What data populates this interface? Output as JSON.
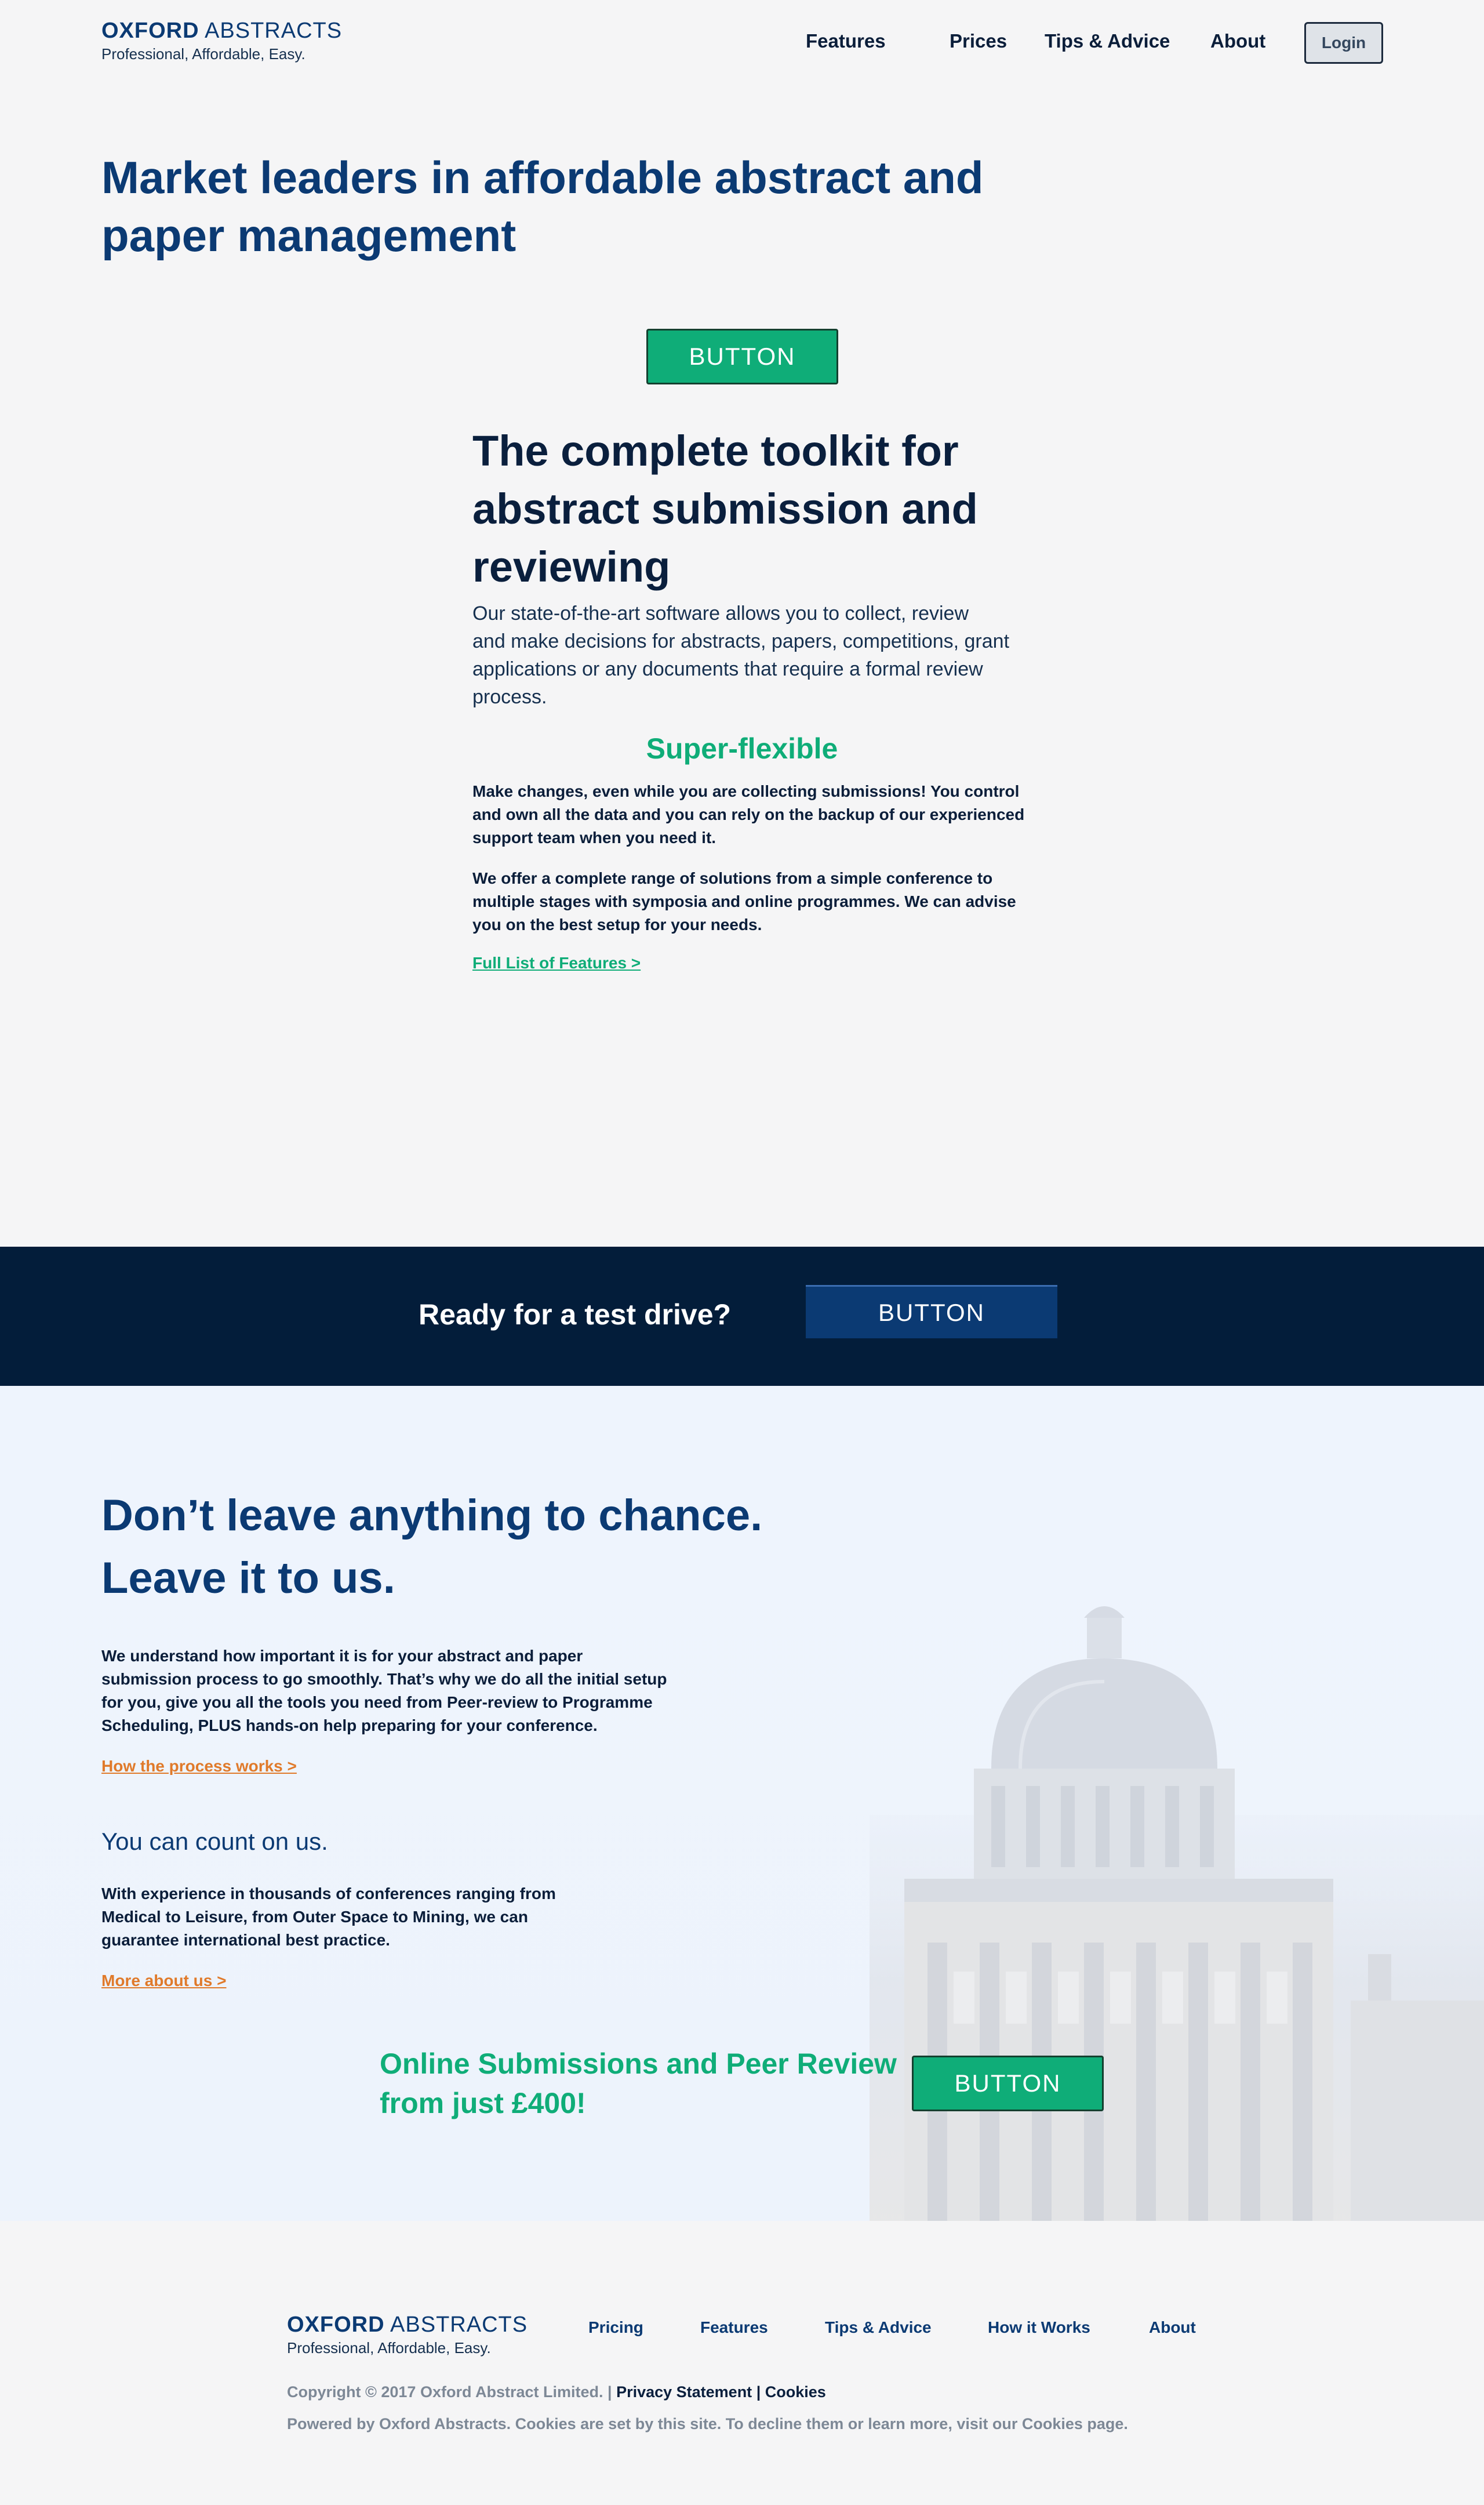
{
  "header": {
    "logo_bold": "OXFORD",
    "logo_light": "ABSTRACTS",
    "tagline": "Professional, Affordable, Easy.",
    "nav": [
      "Features",
      "Prices",
      "Tips & Advice",
      "About"
    ],
    "login_label": "Login"
  },
  "hero": {
    "title_line1": "Market leaders in affordable abstract and",
    "title_line2": "paper management",
    "button_label": "BUTTON"
  },
  "toolkit": {
    "title_line1": "The complete toolkit for",
    "title_line2": "abstract submission and",
    "title_line3": "reviewing",
    "body_line1": "Our state-of-the-art software allows you to collect, review",
    "body_line2": "and make decisions for abstracts, papers, competitions, grant",
    "body_line3": "applications or any documents that require a formal review",
    "body_line4": "process.",
    "flex_heading": "Super-flexible",
    "para1_line1": "Make changes, even while you are collecting submissions! You control",
    "para1_line2": "and own all the data and you can rely on the backup of our experienced",
    "para1_line3": "support team when you need it.",
    "para2_line1": "We offer a complete range of solutions from a simple conference to",
    "para2_line2": "multiple stages with symposia and online programmes.  We can advise",
    "para2_line3": "you on the best setup for your needs.",
    "features_link": "Full List of Features  >"
  },
  "cta_band": {
    "text": "Ready for a test drive?",
    "button_label": "BUTTON"
  },
  "chance": {
    "title_line1": "Don’t leave anything to chance.",
    "title_line2": "Leave it to us.",
    "body_line1": "We understand how important it is for your abstract and paper",
    "body_line2": "submission process to go smoothly. That’s why we do all the initial setup",
    "body_line3": "for you, give you all the tools you need from Peer-review to Programme",
    "body_line4": "Scheduling, PLUS hands-on help preparing for your conference.",
    "process_link": "How the process works  >",
    "count_title": "You can count on us.",
    "count_line1": "With experience in thousands of conferences ranging from",
    "count_line2": "Medical to Leisure, from Outer Space to Mining, we can",
    "count_line3": "guarantee international best practice.",
    "about_link": "More about us  >",
    "promo_line1": "Online Submissions and Peer Review",
    "promo_line2": "from just £400!",
    "button_label": "BUTTON"
  },
  "footer": {
    "logo_bold": "OXFORD",
    "logo_light": "ABSTRACTS",
    "tagline": "Professional, Affordable, Easy.",
    "nav": [
      "Pricing",
      "Features",
      "Tips & Advice",
      "How it Works",
      "About"
    ],
    "copyright": "Copyright © 2017 Oxford Abstract Limited. |",
    "privacy": "Privacy Statement",
    "sep": "|",
    "cookies": "Cookies",
    "powered": "Powered by Oxford Abstracts. Cookies are set by this site. To decline them or learn more, visit our Cookies page."
  },
  "colors": {
    "brand_blue": "#0b3a73",
    "navy": "#031d3a",
    "green": "#0fad78",
    "orange": "#e07a2a"
  }
}
